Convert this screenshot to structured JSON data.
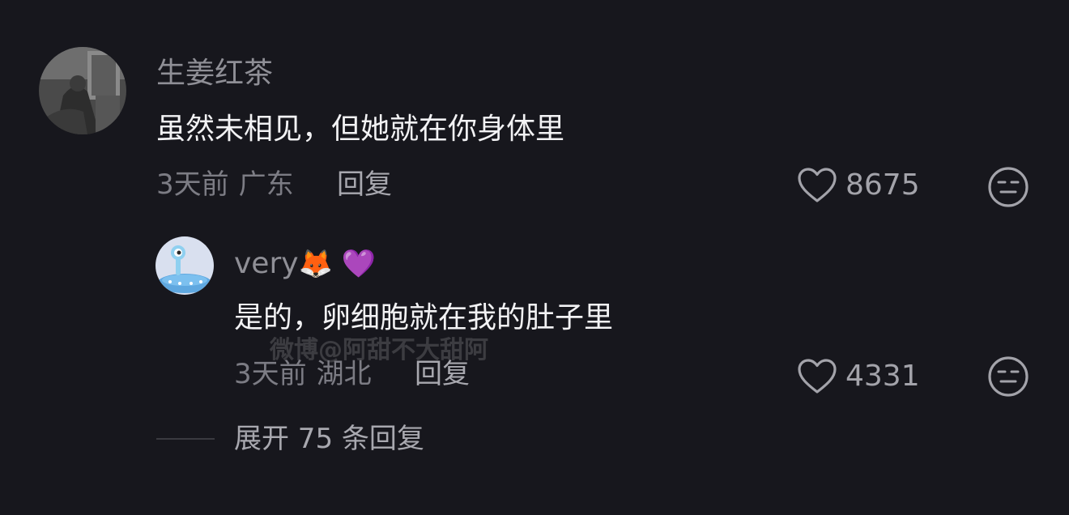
{
  "comment": {
    "username": "生姜红茶",
    "text": "虽然未相见，但她就在你身体里",
    "time": "3天前",
    "region": "广东",
    "reply_label": "回复",
    "likes": "8675"
  },
  "reply": {
    "username": "very",
    "username_emojis": "🦊 💜",
    "text": "是的，卵细胞就在我的肚子里",
    "time": "3天前",
    "region": "湖北",
    "reply_label": "回复",
    "likes": "4331"
  },
  "expand": {
    "label": "展开 75 条回复"
  },
  "watermark": {
    "text": "微博@阿甜不大甜阿"
  },
  "icons": {
    "like": "heart-outline-icon",
    "emoji": "meh-face-icon"
  },
  "colors": {
    "background": "#17171d",
    "username": "#8f8f96",
    "content": "#f2f2f4",
    "meta": "#7c7c84"
  }
}
